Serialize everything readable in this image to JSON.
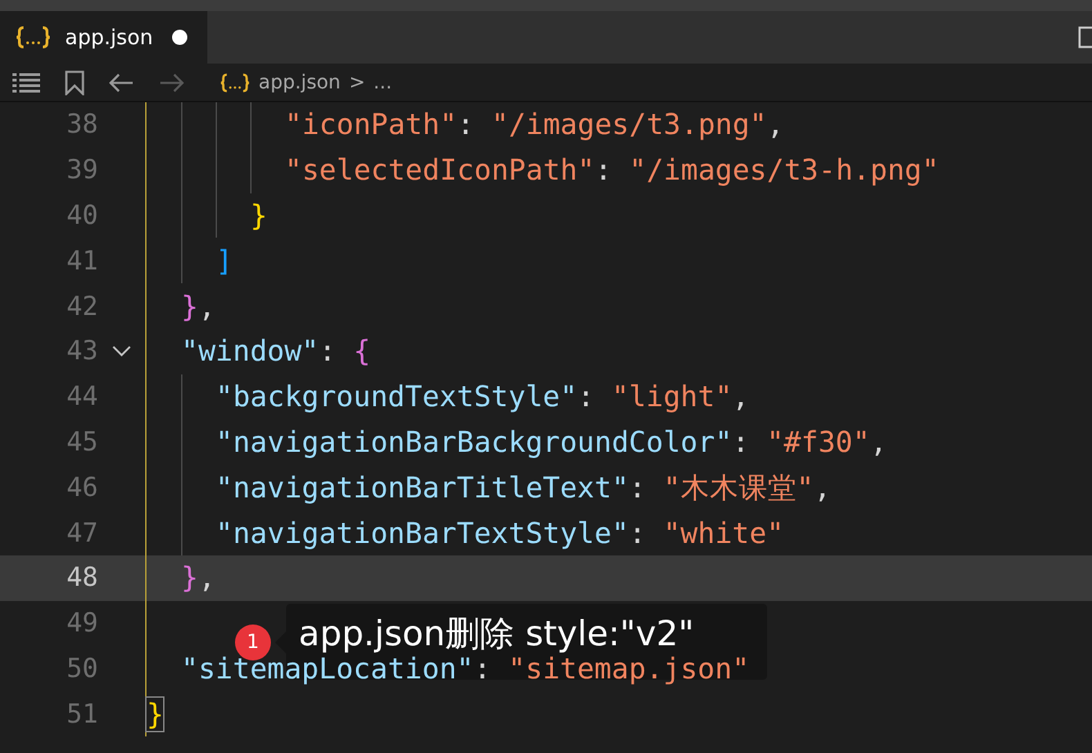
{
  "tabs": [
    {
      "label": "app.json",
      "selected": true,
      "modified": true
    }
  ],
  "breadcrumb": {
    "file": "app.json",
    "separator": ">",
    "more": "..."
  },
  "lines": [
    {
      "children": [
        {
          "children": [
            {
              "children": [
                {
                  "children": [
                    {
                      "number": "38",
                      "current": false,
                      "foldable": false,
                      "tokens": [
                        {
                          "kind": "deep-key",
                          "text": "\"iconPath\""
                        },
                        {
                          "kind": "punct",
                          "text": ": "
                        },
                        {
                          "kind": "string",
                          "text": "\"/images/t3.png\""
                        },
                        {
                          "kind": "punct",
                          "text": ","
                        }
                      ]
                    },
                    {
                      "number": "39",
                      "current": false,
                      "foldable": false,
                      "tokens": [
                        {
                          "kind": "deep-key",
                          "text": "\"selectedIconPath\""
                        },
                        {
                          "kind": "punct",
                          "text": ": "
                        },
                        {
                          "kind": "string",
                          "text": "\"/images/t3-h.png\""
                        }
                      ]
                    }
                  ]
                },
                {
                  "number": "40",
                  "current": false,
                  "foldable": false,
                  "tokens": [
                    {
                      "kind": "bracket",
                      "text": "}",
                      "color": "#ffd700"
                    }
                  ]
                }
              ]
            },
            {
              "number": "41",
              "current": false,
              "foldable": false,
              "tokens": [
                {
                  "kind": "bracket",
                  "text": "]",
                  "color": "#179fff"
                }
              ]
            }
          ]
        },
        {
          "number": "42",
          "current": false,
          "foldable": false,
          "tokens": [
            {
              "kind": "bracket",
              "text": "}",
              "color": "#da70d6"
            },
            {
              "kind": "punct",
              "text": ","
            }
          ]
        },
        {
          "number": "43",
          "current": false,
          "foldable": true,
          "tokens": [
            {
              "kind": "key",
              "text": "\"window\""
            },
            {
              "kind": "punct",
              "text": ": "
            },
            {
              "kind": "bracket",
              "text": "{",
              "color": "#da70d6"
            }
          ]
        },
        {
          "children": [
            {
              "number": "44",
              "current": false,
              "foldable": false,
              "tokens": [
                {
                  "kind": "key",
                  "text": "\"backgroundTextStyle\""
                },
                {
                  "kind": "punct",
                  "text": ": "
                },
                {
                  "kind": "string",
                  "text": "\"light\""
                },
                {
                  "kind": "punct",
                  "text": ","
                }
              ]
            },
            {
              "number": "45",
              "current": false,
              "foldable": false,
              "tokens": [
                {
                  "kind": "key",
                  "text": "\"navigationBarBackgroundColor\""
                },
                {
                  "kind": "punct",
                  "text": ": "
                },
                {
                  "kind": "string",
                  "text": "\"#f30\""
                },
                {
                  "kind": "punct",
                  "text": ","
                }
              ]
            },
            {
              "number": "46",
              "current": false,
              "foldable": false,
              "tokens": [
                {
                  "kind": "key",
                  "text": "\"navigationBarTitleText\""
                },
                {
                  "kind": "punct",
                  "text": ": "
                },
                {
                  "kind": "string",
                  "text": "\"木木课堂\""
                },
                {
                  "kind": "punct",
                  "text": ","
                }
              ]
            },
            {
              "number": "47",
              "current": false,
              "foldable": false,
              "tokens": [
                {
                  "kind": "key",
                  "text": "\"navigationBarTextStyle\""
                },
                {
                  "kind": "punct",
                  "text": ": "
                },
                {
                  "kind": "string",
                  "text": "\"white\""
                }
              ]
            }
          ]
        },
        {
          "number": "48",
          "current": true,
          "foldable": false,
          "tokens": [
            {
              "kind": "bracket",
              "text": "}",
              "color": "#da70d6"
            },
            {
              "kind": "punct",
              "text": ","
            }
          ]
        },
        {
          "number": "49",
          "current": false,
          "foldable": false
        },
        {
          "number": "50",
          "current": false,
          "foldable": false,
          "tokens": [
            {
              "kind": "key",
              "text": "\"sitemapLocation\""
            },
            {
              "kind": "punct",
              "text": ": "
            },
            {
              "kind": "string",
              "text": "\"sitemap.json\""
            }
          ]
        }
      ]
    },
    {
      "number": "51",
      "current": false,
      "foldable": false,
      "tokens": [
        {
          "kind": "bracket",
          "text": "}",
          "color": "#ffd700",
          "matched": true
        }
      ]
    }
  ],
  "callout": {
    "badge": "1",
    "text": "app.json删除 style:\"v2\""
  }
}
